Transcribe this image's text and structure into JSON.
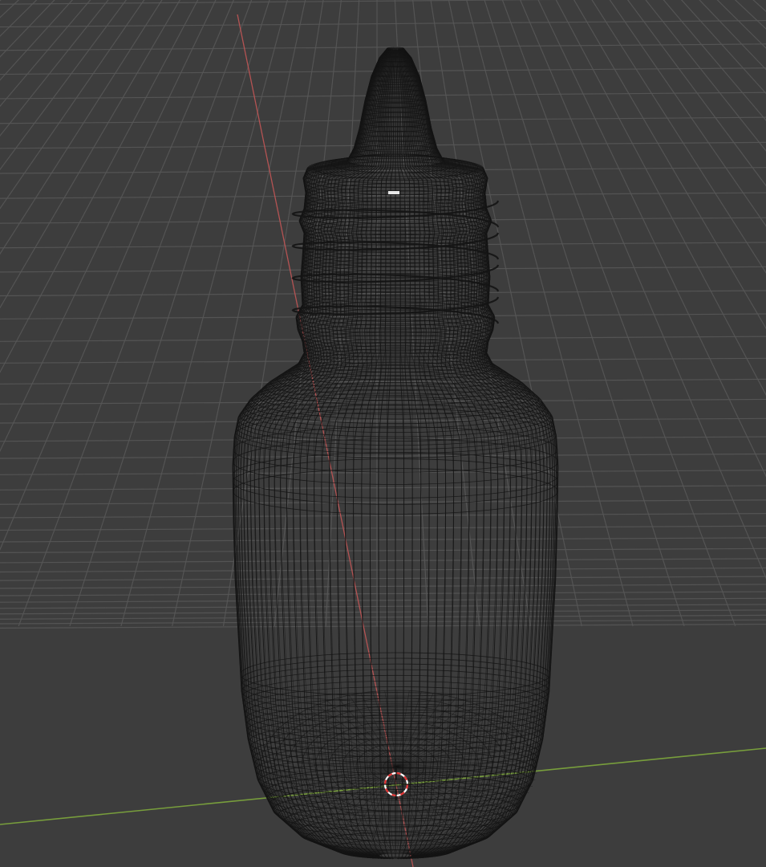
{
  "viewport": {
    "mode": "wireframe",
    "object": "dropper-bottle",
    "colors": {
      "background": "#3d3d3d",
      "grid_line": "#575757",
      "wire": "#141414",
      "x_axis": "#c25555",
      "y_axis": "#7ea83c",
      "cursor_red": "#e03030",
      "cursor_white": "#ffffff",
      "origin_highlight": "#e6e6e6"
    },
    "icons": {
      "cursor": "3d-cursor-icon"
    }
  }
}
